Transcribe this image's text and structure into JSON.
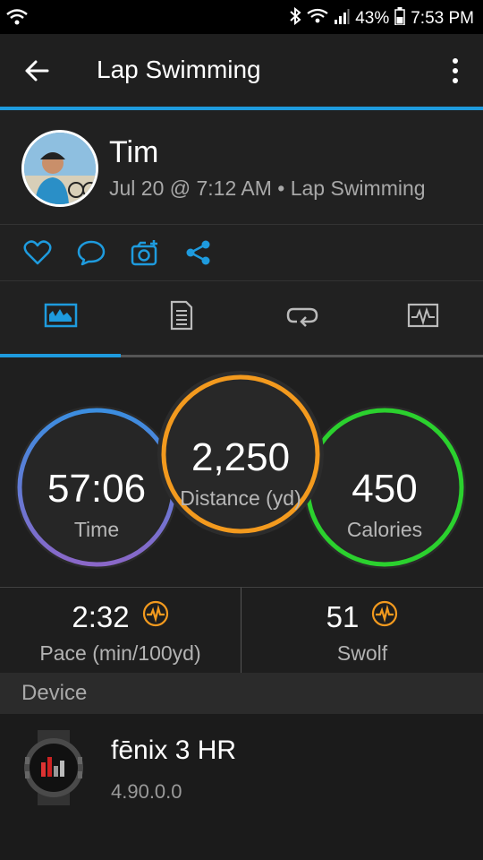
{
  "status_bar": {
    "battery": "43%",
    "time": "7:53 PM"
  },
  "header": {
    "title": "Lap Swimming"
  },
  "profile": {
    "name": "Tim",
    "subtitle": "Jul 20 @ 7:12 AM • Lap Swimming"
  },
  "actions": [
    "heart-icon",
    "comment-icon",
    "add-photo-icon",
    "share-icon"
  ],
  "tabs": [
    "overview",
    "details",
    "laps",
    "charts"
  ],
  "stats": {
    "time": {
      "value": "57:06",
      "label": "Time"
    },
    "distance": {
      "value": "2,250",
      "label": "Distance (yd)"
    },
    "calories": {
      "value": "450",
      "label": "Calories"
    }
  },
  "metrics": {
    "pace": {
      "value": "2:32",
      "label": "Pace (min/100yd)"
    },
    "swolf": {
      "value": "51",
      "label": "Swolf"
    }
  },
  "device_section": {
    "title": "Device",
    "name": "fēnix 3 HR",
    "version": "4.90.0.0"
  },
  "colors": {
    "accent": "#1e9bde",
    "time_ring": "#3f7fd4",
    "distance_ring": "#f39a1e",
    "calories_ring": "#2bd12e",
    "metric_icon": "#f39a1e"
  }
}
